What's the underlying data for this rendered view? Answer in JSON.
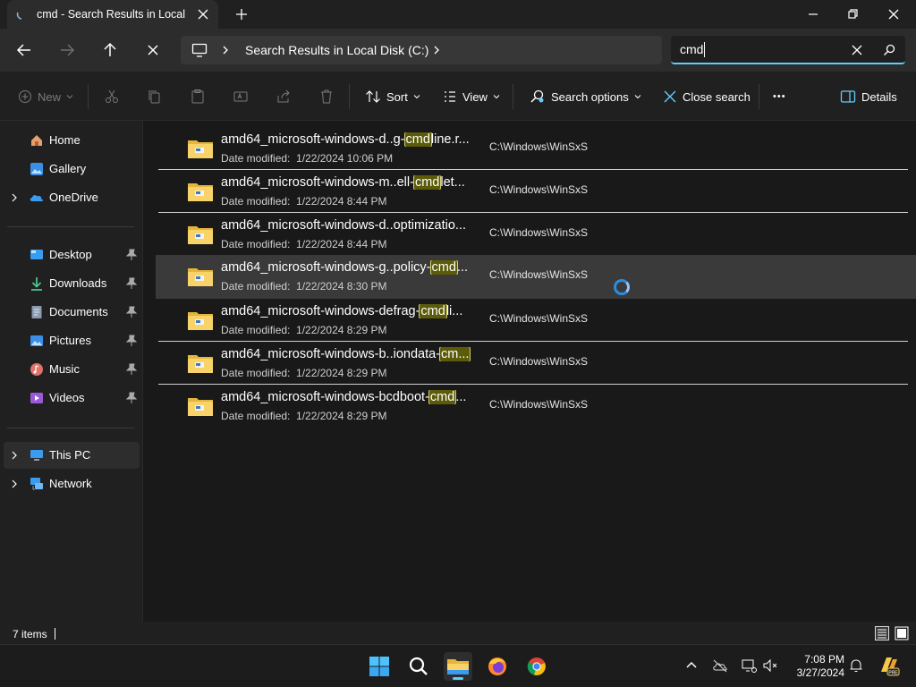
{
  "window": {
    "tab_title": "cmd - Search Results in Local Disk (C:)",
    "new_tab": "+",
    "controls": [
      "minimize",
      "maximize",
      "close"
    ]
  },
  "address": {
    "breadcrumb": "Search Results in Local Disk (C:)",
    "search_value": "cmd"
  },
  "toolbar": {
    "new_label": "New",
    "sort_label": "Sort",
    "view_label": "View",
    "search_options_label": "Search options",
    "close_search_label": "Close search",
    "more_label": "•••",
    "details_label": "Details"
  },
  "sidebar": {
    "items": [
      {
        "label": "Home",
        "icon": "home-icon"
      },
      {
        "label": "Gallery",
        "icon": "gallery-icon"
      },
      {
        "label": "OneDrive",
        "icon": "onedrive-icon"
      },
      {
        "label": "Desktop",
        "icon": "desktop-icon"
      },
      {
        "label": "Downloads",
        "icon": "downloads-icon"
      },
      {
        "label": "Documents",
        "icon": "documents-icon"
      },
      {
        "label": "Pictures",
        "icon": "pictures-icon"
      },
      {
        "label": "Music",
        "icon": "music-icon"
      },
      {
        "label": "Videos",
        "icon": "videos-icon"
      },
      {
        "label": "This PC",
        "icon": "this-pc-icon"
      },
      {
        "label": "Network",
        "icon": "network-icon"
      }
    ]
  },
  "results": {
    "meta_prefix": "Date modified:",
    "rows": [
      {
        "pre": "amd64_microsoft-windows-d..g-",
        "match": "cmd",
        "post": "line.r...",
        "date": "1/22/2024 10:06 PM",
        "location": "C:\\Windows\\WinSxS"
      },
      {
        "pre": "amd64_microsoft-windows-m..ell-",
        "match": "cmd",
        "post": "let...",
        "date": "1/22/2024 8:44 PM",
        "location": "C:\\Windows\\WinSxS"
      },
      {
        "pre": "amd64_microsoft-windows-d..optimizatio...",
        "match": "",
        "post": "",
        "date": "1/22/2024 8:44 PM",
        "location": "C:\\Windows\\WinSxS"
      },
      {
        "pre": "amd64_microsoft-windows-g..policy-",
        "match": "cmd",
        "post": "...",
        "date": "1/22/2024 8:30 PM",
        "location": "C:\\Windows\\WinSxS"
      },
      {
        "pre": "amd64_microsoft-windows-defrag-",
        "match": "cmd",
        "post": "li...",
        "date": "1/22/2024 8:29 PM",
        "location": "C:\\Windows\\WinSxS"
      },
      {
        "pre": "amd64_microsoft-windows-b..iondata-",
        "match": "cm...",
        "post": "",
        "date": "1/22/2024 8:29 PM",
        "location": "C:\\Windows\\WinSxS"
      },
      {
        "pre": "amd64_microsoft-windows-bcdboot-",
        "match": "cmd",
        "post": "...",
        "date": "1/22/2024 8:29 PM",
        "location": "C:\\Windows\\WinSxS"
      }
    ]
  },
  "status": {
    "count": "7 items"
  },
  "taskbar": {
    "apps": [
      "start-icon",
      "search-icon",
      "file-explorer-icon",
      "firefox-icon",
      "chrome-icon"
    ],
    "time": "7:08 PM",
    "date": "3/27/2024"
  },
  "colors": {
    "accent": "#60cdff",
    "highlight_bg": "#5b5b0a",
    "folder": "#f3c94f"
  }
}
